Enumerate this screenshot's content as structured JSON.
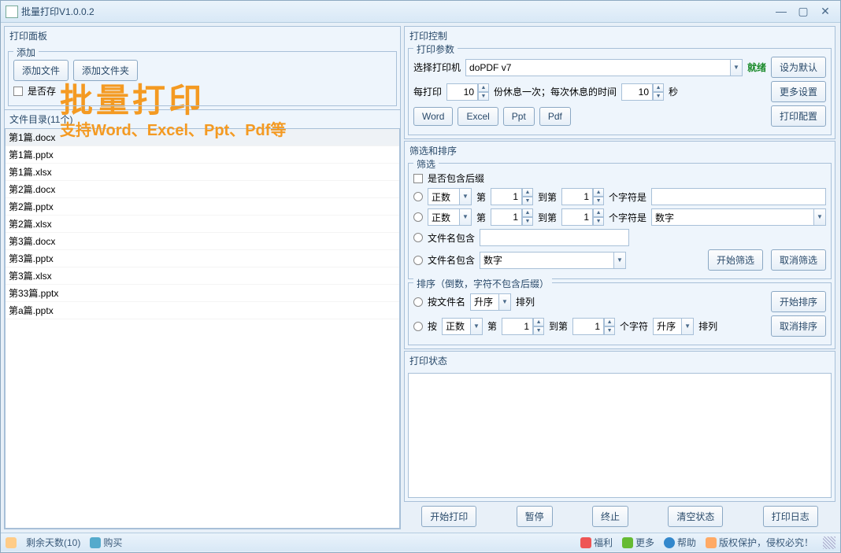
{
  "window": {
    "title": "批量打印V1.0.0.2"
  },
  "left": {
    "panel_title": "打印面板",
    "add_title": "添加",
    "add_file": "添加文件",
    "add_folder": "添加文件夹",
    "is_save": "是否存",
    "file_list_title": "文件目录(11个)",
    "files": [
      "第1篇.docx",
      "第1篇.pptx",
      "第1篇.xlsx",
      "第2篇.docx",
      "第2篇.pptx",
      "第2篇.xlsx",
      "第3篇.docx",
      "第3篇.pptx",
      "第3篇.xlsx",
      "第33篇.pptx",
      "第a篇.pptx"
    ]
  },
  "watermark": {
    "big": "批量打印",
    "sub": "支持Word、Excel、Ppt、Pdf等"
  },
  "ctrl": {
    "panel_title": "打印控制",
    "param_title": "打印参数",
    "select_printer": "选择打印机",
    "printer": "doPDF v7",
    "ready": "就绪",
    "set_default": "设为默认",
    "per_print": "每打印",
    "per_print_val": "10",
    "rest_once": "份休息一次；每次休息的时间",
    "rest_val": "10",
    "sec": "秒",
    "more_settings": "更多设置",
    "print_config": "打印配置",
    "btn_word": "Word",
    "btn_excel": "Excel",
    "btn_ppt": "Ppt",
    "btn_pdf": "Pdf"
  },
  "filter": {
    "panel_title": "筛选和排序",
    "filter_title": "筛选",
    "include_suffix": "是否包含后缀",
    "pos": "正数",
    "num_label": "第",
    "val1": "1",
    "to": "到第",
    "char_is": "个字符是",
    "digit": "数字",
    "name_contain": "文件名包含",
    "start": "开始筛选",
    "cancel": "取消筛选",
    "sort_title": "排序（倒数，字符不包含后缀）",
    "by_name": "按文件名",
    "asc": "升序",
    "arrange": "排列",
    "by": "按",
    "char": "个字符",
    "start_sort": "开始排序",
    "cancel_sort": "取消排序"
  },
  "status": {
    "title": "打印状态"
  },
  "actions": {
    "start": "开始打印",
    "pause": "暂停",
    "stop": "终止",
    "clear": "清空状态",
    "log": "打印日志"
  },
  "statusbar": {
    "days": "剩余天数(10)",
    "buy": "购买",
    "welfare": "福利",
    "more": "更多",
    "help": "帮助",
    "copyright": "版权保护，侵权必究！"
  }
}
